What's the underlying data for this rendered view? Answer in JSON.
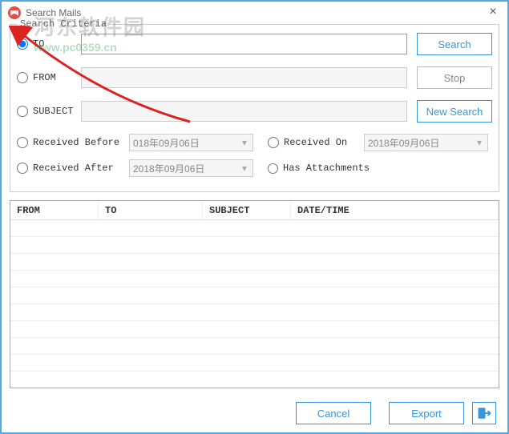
{
  "window": {
    "title": "Search Mails",
    "close_icon": "×"
  },
  "watermark": {
    "line1": "河东软件园",
    "line2": "www.pc0359.cn"
  },
  "criteria": {
    "legend": "Search Criteria",
    "to_label": "TO",
    "from_label": "FROM",
    "subject_label": "SUBJECT",
    "received_before_label": "Received Before",
    "received_before_value": "018年09月06日",
    "received_on_label": "Received On",
    "received_on_value": "2018年09月06日",
    "received_after_label": "Received After",
    "received_after_value": "2018年09月06日",
    "has_attachments_label": "Has Attachments"
  },
  "buttons": {
    "search": "Search",
    "stop": "Stop",
    "new_search": "New Search",
    "cancel": "Cancel",
    "export": "Export"
  },
  "results": {
    "columns": {
      "from": "FROM",
      "to": "TO",
      "subject": "SUBJECT",
      "datetime": "DATE/TIME"
    }
  },
  "colors": {
    "accent": "#3498db",
    "border": "#54a8e8"
  }
}
